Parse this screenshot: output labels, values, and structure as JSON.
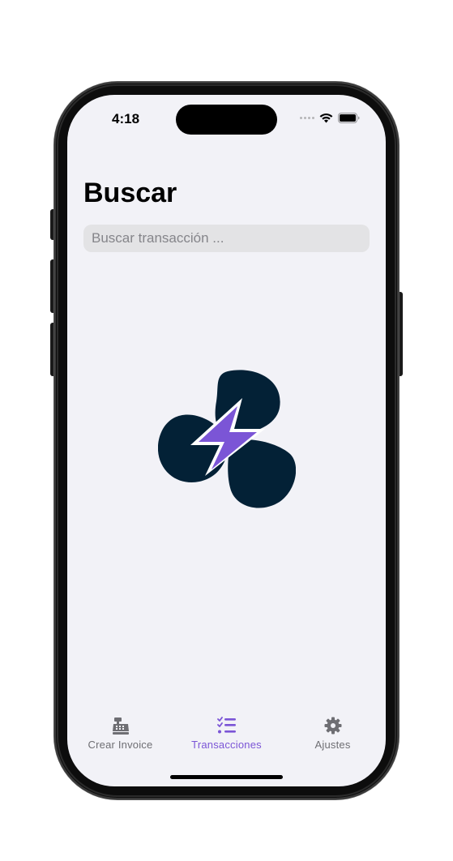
{
  "status_bar": {
    "time": "4:18"
  },
  "page": {
    "title": "Buscar"
  },
  "search": {
    "placeholder": "Buscar transacción ...",
    "value": ""
  },
  "tabs": [
    {
      "label": "Crear Invoice",
      "icon": "cash-register-icon",
      "active": false
    },
    {
      "label": "Transacciones",
      "icon": "list-check-icon",
      "active": true
    },
    {
      "label": "Ajustes",
      "icon": "gear-icon",
      "active": false
    }
  ],
  "colors": {
    "accent": "#7b55d6",
    "background": "#f2f2f7",
    "logo_dark": "#032136",
    "inactive": "#6e6e73"
  }
}
